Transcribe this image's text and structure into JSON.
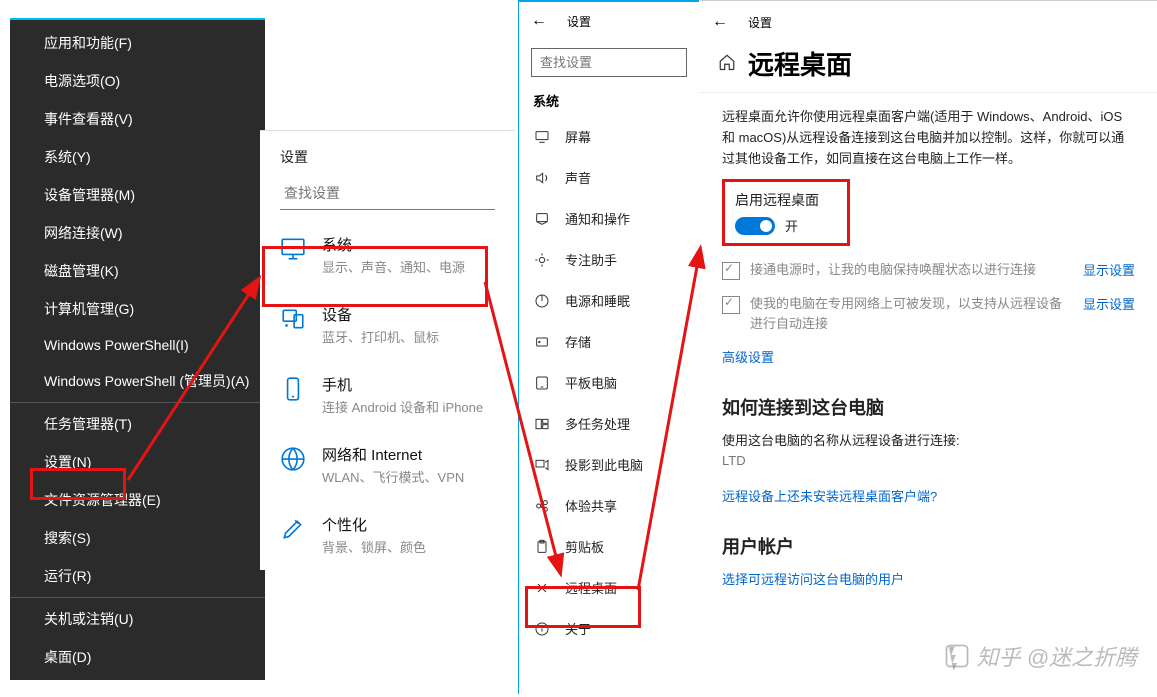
{
  "context_menu": {
    "items": [
      "应用和功能(F)",
      "电源选项(O)",
      "事件查看器(V)",
      "系统(Y)",
      "设备管理器(M)",
      "网络连接(W)",
      "磁盘管理(K)",
      "计算机管理(G)",
      "Windows PowerShell(I)",
      "Windows PowerShell (管理员)(A)",
      "任务管理器(T)",
      "设置(N)",
      "文件资源管理器(E)",
      "搜索(S)",
      "运行(R)",
      "关机或注销(U)",
      "桌面(D)"
    ]
  },
  "settings_home": {
    "title": "设置",
    "search_placeholder": "查找设置",
    "categories": [
      {
        "icon": "monitor",
        "title": "系统",
        "subtitle": "显示、声音、通知、电源"
      },
      {
        "icon": "devices",
        "title": "设备",
        "subtitle": "蓝牙、打印机、鼠标"
      },
      {
        "icon": "phone",
        "title": "手机",
        "subtitle": "连接 Android 设备和 iPhone"
      },
      {
        "icon": "globe",
        "title": "网络和 Internet",
        "subtitle": "WLAN、飞行模式、VPN"
      },
      {
        "icon": "brush",
        "title": "个性化",
        "subtitle": "背景、锁屏、颜色"
      }
    ]
  },
  "system_sidebar": {
    "header": "设置",
    "search_placeholder": "查找设置",
    "group_title": "系统",
    "items": [
      {
        "icon": "display",
        "label": "屏幕"
      },
      {
        "icon": "sound",
        "label": "声音"
      },
      {
        "icon": "notify",
        "label": "通知和操作"
      },
      {
        "icon": "focus",
        "label": "专注助手"
      },
      {
        "icon": "power",
        "label": "电源和睡眠"
      },
      {
        "icon": "storage",
        "label": "存储"
      },
      {
        "icon": "tablet",
        "label": "平板电脑"
      },
      {
        "icon": "multitask",
        "label": "多任务处理"
      },
      {
        "icon": "project",
        "label": "投影到此电脑"
      },
      {
        "icon": "shared",
        "label": "体验共享"
      },
      {
        "icon": "clipboard",
        "label": "剪贴板"
      },
      {
        "icon": "remote",
        "label": "远程桌面"
      },
      {
        "icon": "about",
        "label": "关于"
      }
    ]
  },
  "remote_desktop": {
    "header": "设置",
    "title": "远程桌面",
    "description": "远程桌面允许你使用远程桌面客户端(适用于 Windows、Android、iOS 和 macOS)从远程设备连接到这台电脑并加以控制。这样，你就可以通过其他设备工作，如同直接在这台电脑上工作一样。",
    "enable_label": "启用远程桌面",
    "toggle_state": "开",
    "check1": "接通电源时，让我的电脑保持唤醒状态以进行连接",
    "check2": "使我的电脑在专用网络上可被发现，以支持从远程设备进行自动连接",
    "show_settings": "显示设置",
    "advanced": "高级设置",
    "how_connect_title": "如何连接到这台电脑",
    "how_connect_desc": "使用这台电脑的名称从远程设备进行连接:",
    "pc_name": "LTD",
    "no_client_link": "远程设备上还未安装远程桌面客户端?",
    "user_acct_title": "用户帐户",
    "user_acct_link": "选择可远程访问这台电脑的用户"
  },
  "watermark": "知乎 @迷之折腾"
}
